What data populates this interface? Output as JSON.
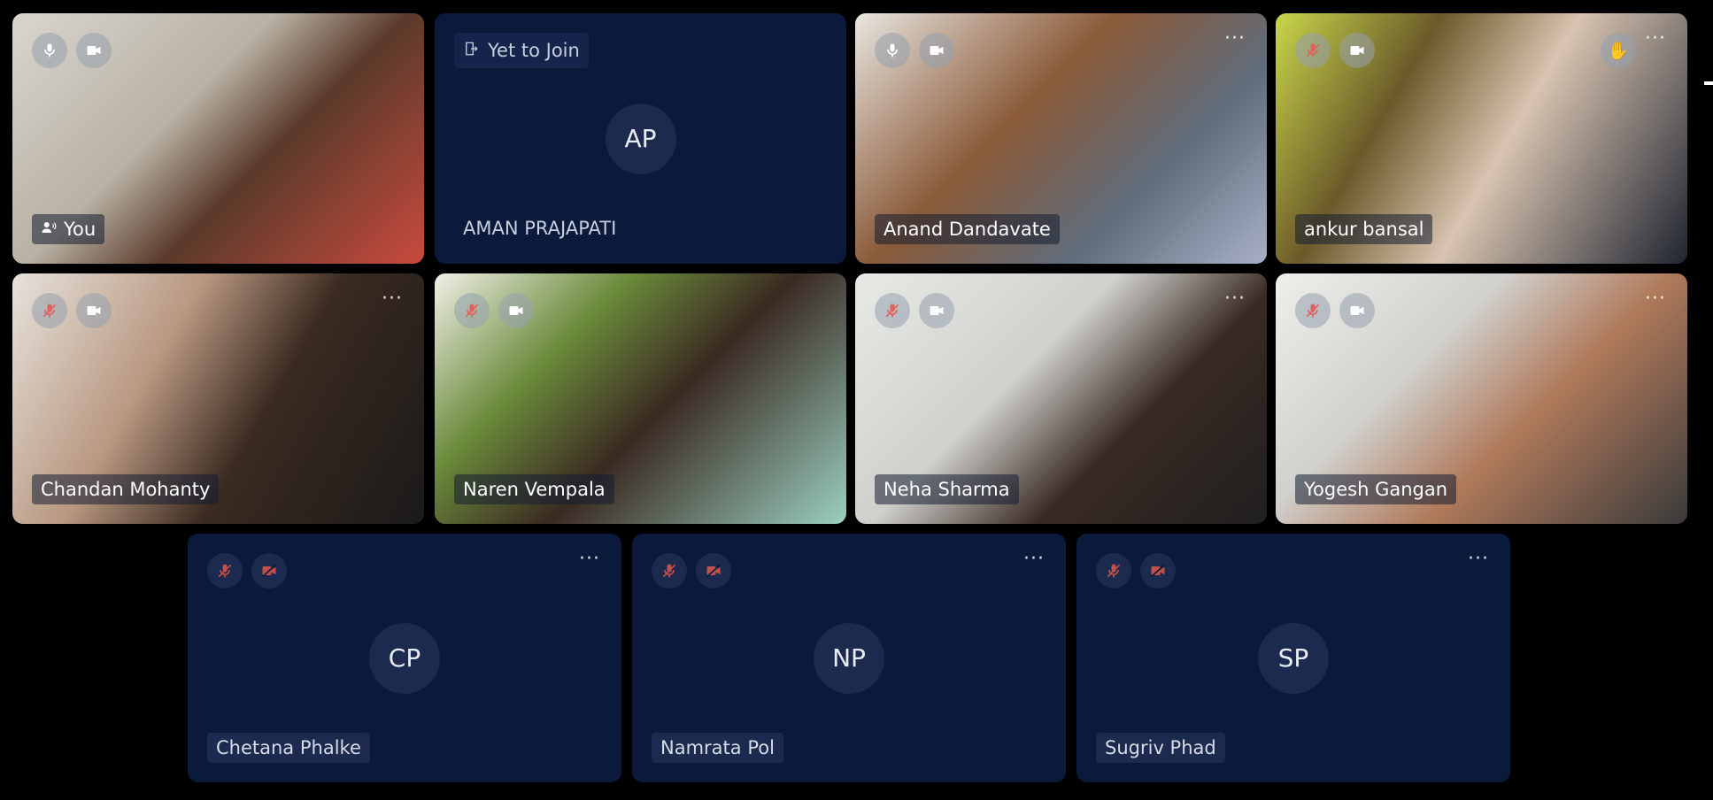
{
  "participants": [
    {
      "name": "You",
      "mic": "on",
      "cam": "on",
      "type": "video",
      "speaker": true,
      "bg": "linear-gradient(135deg,#d9d6cf 0%,#b8b1a3 40%,#5a3a2a 60%,#c94a3d 100%)"
    },
    {
      "name": "AMAN PRAJAPATI",
      "initials": "AP",
      "status": "Yet to Join",
      "type": "pending"
    },
    {
      "name": "Anand Dandavate",
      "mic": "on",
      "cam": "on",
      "type": "video",
      "more": "···",
      "bg": "linear-gradient(135deg,#e9e6e0 0%,#8a5a38 40%,#5f6d7c 70%,#a8b0c8 100%)"
    },
    {
      "name": "ankur bansal",
      "mic": "off",
      "cam": "on",
      "type": "video",
      "more": "···",
      "hand": true,
      "bg": "linear-gradient(120deg,#c9d64a 0%,#6b5a2a 30%,#d8c4b0 55%,#1f2430 100%)"
    },
    {
      "name": "Chandan Mohanty",
      "mic": "off",
      "cam": "on",
      "type": "video",
      "more": "···",
      "bg": "linear-gradient(120deg,#e7e2dc 0%,#b89880 35%,#3a2a20 60%,#1a1a1a 100%)"
    },
    {
      "name": "Naren Vempala",
      "mic": "off",
      "cam": "on",
      "type": "video",
      "bg": "linear-gradient(135deg,#f0f0e6 0%,#6a8a3a 30%,#3a2a22 55%,#9ad0c0 100%)"
    },
    {
      "name": "Neha Sharma",
      "mic": "off",
      "cam": "on",
      "type": "video",
      "more": "···",
      "bg": "linear-gradient(135deg,#e8eae6 0%,#cfd0cc 40%,#3a2a24 65%,#1f1f1f 100%)"
    },
    {
      "name": "Yogesh Gangan",
      "mic": "off",
      "cam": "on",
      "type": "video",
      "more": "···",
      "bg": "linear-gradient(135deg,#eeeeea 0%,#d0d0cc 35%,#b07a5a 60%,#3a3a3a 100%)"
    },
    {
      "name": "Chetana Phalke",
      "initials": "CP",
      "mic": "off",
      "cam": "off",
      "type": "avatar",
      "more": "···"
    },
    {
      "name": "Namrata Pol",
      "initials": "NP",
      "mic": "off",
      "cam": "off",
      "type": "avatar",
      "more": "···"
    },
    {
      "name": "Sugriv Phad",
      "initials": "SP",
      "mic": "off",
      "cam": "off",
      "type": "avatar",
      "more": "···"
    }
  ],
  "colors": {
    "tile_bg": "#0b1a3a",
    "off_red": "#e0625a",
    "icon_white": "#ffffff"
  },
  "icons": {
    "mic": "mic-icon",
    "mic_off": "mic-off-icon",
    "cam": "camera-icon",
    "cam_off": "camera-off-icon",
    "speaker": "speaker-icon",
    "leave": "door-exit-icon",
    "hand": "raise-hand-icon"
  }
}
